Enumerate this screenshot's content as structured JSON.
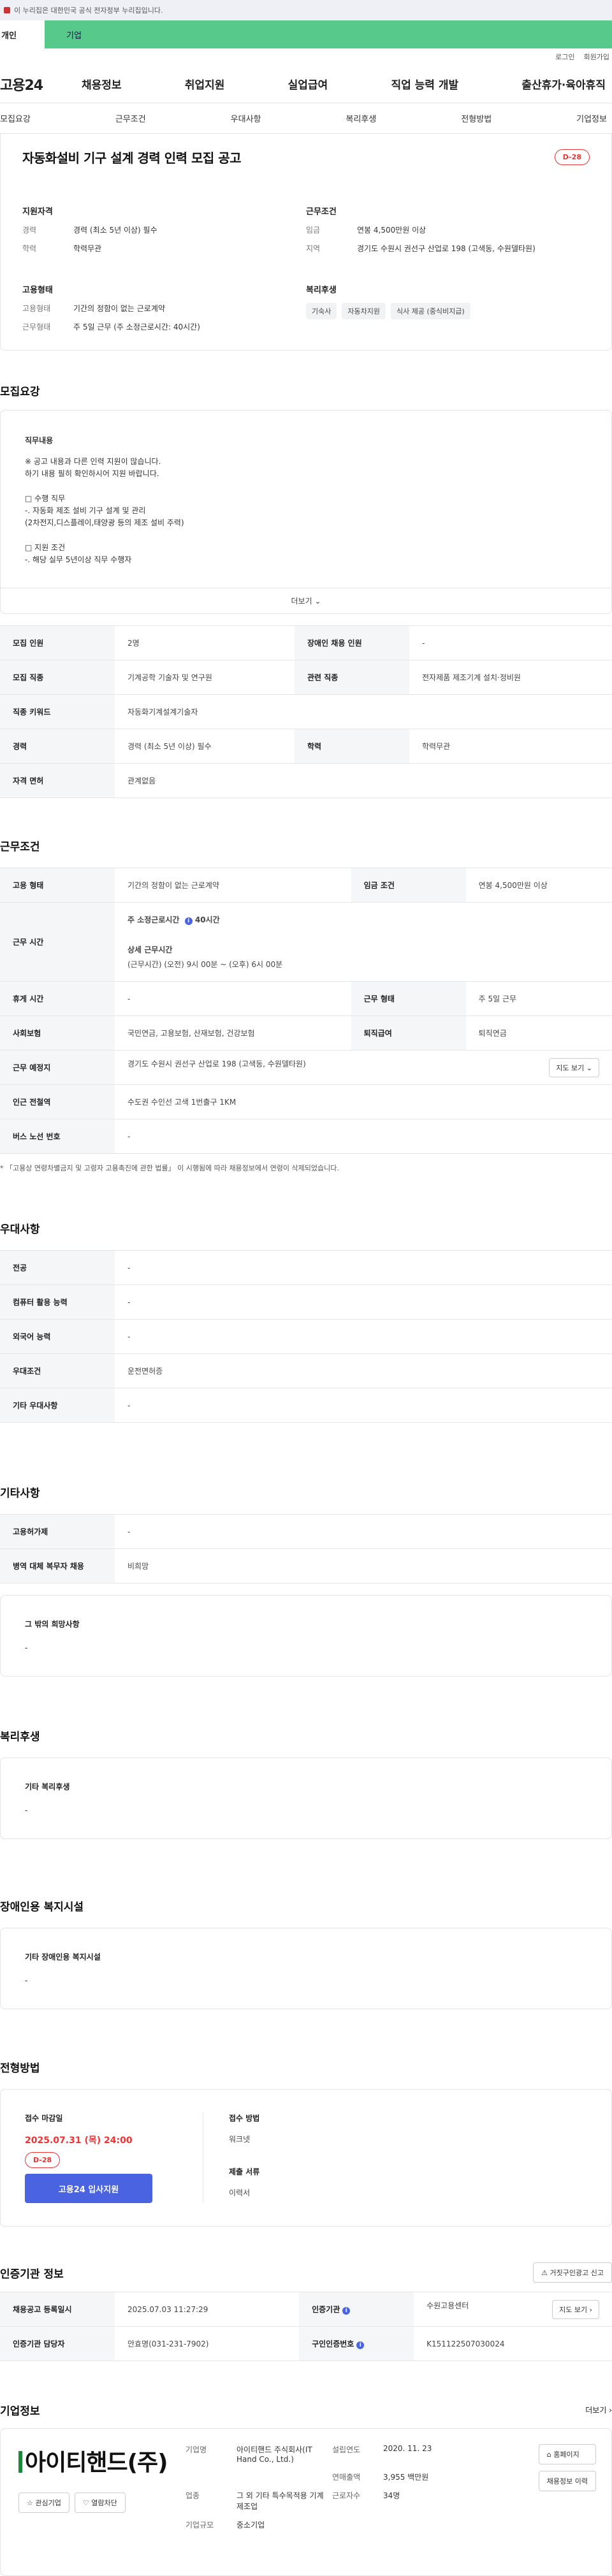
{
  "banner": {
    "text": "이 누리집은 대한민국 공식 전자정부 누리집입니다."
  },
  "tabs": {
    "personal": "개인",
    "company": "기업"
  },
  "util": {
    "login": "로그인",
    "join": "회원가입"
  },
  "gnb": {
    "logo": "고용24",
    "menus": [
      "채용정보",
      "취업지원",
      "실업급여",
      "직업 능력 개발",
      "출산휴가·육아휴직"
    ]
  },
  "anchors": [
    "모집요강",
    "근무조건",
    "우대사항",
    "복리후생",
    "전형방법",
    "기업정보"
  ],
  "summary": {
    "title": "자동화설비 기구 설계 경력 인력 모집 공고",
    "dday": "D-28",
    "qual": {
      "title": "지원자격",
      "career_k": "경력",
      "career_v": "경력 (최소 5년 이상) 필수",
      "edu_k": "학력",
      "edu_v": "학력무관"
    },
    "cond": {
      "title": "근무조건",
      "wage_k": "임금",
      "wage_v": "연봉 4,500만원 이상",
      "loc_k": "지역",
      "loc_v": "경기도 수원시 권선구 산업로 198 (고색동, 수원델타원)"
    },
    "emp": {
      "title": "고용형태",
      "type_k": "고용형태",
      "type_v": "기간의 정함이 없는 근로계약",
      "work_k": "근무형태",
      "work_v": "주 5일 근무 (주 소정근로시간: 40시간)"
    },
    "welfare": {
      "title": "복리후생",
      "tags": [
        "기숙사",
        "자동차지원",
        "식사 제공 (중식비지급)"
      ]
    }
  },
  "recruit": {
    "title": "모집요강",
    "desc_title": "직무내용",
    "desc": "※ 공고 내용과 다른 인력 지원이 많습니다.\n   하기 내용 필히 확인하시어 지원 바랍니다.\n\n□ 수행 직무\n  -. 자동화 제조 설비 기구 설계 및 관리\n     (2차전지,디스플레이,태양광 등의 제조 설비 주력)\n\n□ 지원 조건\n  -. 해당 실무 5년이상 직무 수행자",
    "more": "더보기",
    "rows": {
      "count_k": "모집 인원",
      "count_v": "2명",
      "disabled_k": "장애인 채용 인원",
      "disabled_v": "-",
      "job_k": "모집 직종",
      "job_v": "기계공학 기술자 및 연구원",
      "rel_k": "관련 직종",
      "rel_v": "전자제품 제조기계 설치·정비원",
      "kw_k": "직종 키워드",
      "kw_v": "자동화기계설계기술자",
      "career_k": "경력",
      "career_v": "경력 (최소 5년 이상) 필수",
      "edu_k": "학력",
      "edu_v": "학력무관",
      "license_k": "자격 면허",
      "license_v": "관계없음"
    }
  },
  "work": {
    "title": "근무조건",
    "type_k": "고용 형태",
    "type_v": "기간의 정함이 없는 근로계약",
    "wage_k": "임금 조건",
    "wage_v": "연봉 4,500만원 이상",
    "hours_k": "근무 시간",
    "hours_weekly": "주 소정근로시간",
    "hours_weekly_v": "40시간",
    "hours_detail": "상세 근무시간",
    "hours_detail_v": "(근무시간) (오전) 9시 00분 ~ (오후) 6시 00분",
    "rest_k": "휴게 시간",
    "rest_v": "-",
    "form_k": "근무 형태",
    "form_v": "주 5일 근무",
    "ins_k": "사회보험",
    "ins_v": "국민연금, 고용보험, 산재보험, 건강보험",
    "ret_k": "퇴직급여",
    "ret_v": "퇴직연금",
    "place_k": "근무 예정지",
    "place_v": "경기도 수원시 권선구 산업로 198 (고색동, 수원델타원)",
    "map": "지도 보기",
    "station_k": "인근 전철역",
    "station_v": "수도권 수인선 고색 1번출구 1KM",
    "bus_k": "버스 노선 번호",
    "bus_v": "-",
    "notice": "* 「고용상 연령차별금지 및 고령자 고용촉진에 관한 법률」 이 시행됨에 따라 채용정보에서 연령이 삭제되었습니다."
  },
  "pref": {
    "title": "우대사항",
    "major_k": "전공",
    "major_v": "-",
    "pc_k": "컴퓨터 활용 능력",
    "pc_v": "-",
    "lang_k": "외국어 능력",
    "lang_v": "-",
    "cond_k": "우대조건",
    "cond_v": "운전면허증",
    "etc_k": "기타 우대사항",
    "etc_v": "-"
  },
  "other": {
    "title": "기타사항",
    "visa_k": "고용허가제",
    "visa_v": "-",
    "mil_k": "병역 대체 복무자 채용",
    "mil_v": "비희망",
    "hope_title": "그 밖의 희망사항",
    "hope_v": "-"
  },
  "welfare": {
    "title": "복리후생",
    "sub_title": "기타 복리후생",
    "sub_v": "-"
  },
  "disabled": {
    "title": "장애인용 복지시설",
    "sub_title": "기타 장애인용 복지시설",
    "sub_v": "-"
  },
  "screen": {
    "title": "전형방법",
    "deadline_k": "접수 마감일",
    "deadline_v": "2025.07.31 (목) 24:00",
    "dday": "D-28",
    "apply_btn": "고용24 입사지원",
    "method_k": "접수 방법",
    "method_v": "워크넷",
    "docs_k": "제출 서류",
    "docs_v": "이력서"
  },
  "cert": {
    "title": "인증기관 정보",
    "report_btn": "거짓구인광고 신고",
    "reg_k": "채용공고 등록일시",
    "reg_v": "2025.07.03 11:27:29",
    "agency_k": "인증기관",
    "agency_v": "수원고용센터",
    "map": "지도 보기",
    "mgr_k": "인증기관 담당자",
    "mgr_v": "안효명(031-231-7902)",
    "num_k": "구인인증번호",
    "num_v": "K151122507030024"
  },
  "company": {
    "title": "기업정보",
    "more": "더보기",
    "logo": "아이티핸드(주)",
    "fav": "관심기업",
    "block": "열람차단",
    "name_k": "기업명",
    "name_v": "아이티핸드 주식회사(IT Hand Co., Ltd.)",
    "est_k": "설립연도",
    "est_v": "2020. 11. 23",
    "sales_k": "연매출액",
    "sales_v": "3,955 백만원",
    "emp_k": "근로자수",
    "emp_v": "34명",
    "ind_k": "업종",
    "ind_v": "그 외 기타 특수목적용 기계 제조업",
    "size_k": "기업규모",
    "size_v": "중소기업",
    "home_btn": "홈페이지",
    "hist_btn": "채용정보 이력"
  }
}
